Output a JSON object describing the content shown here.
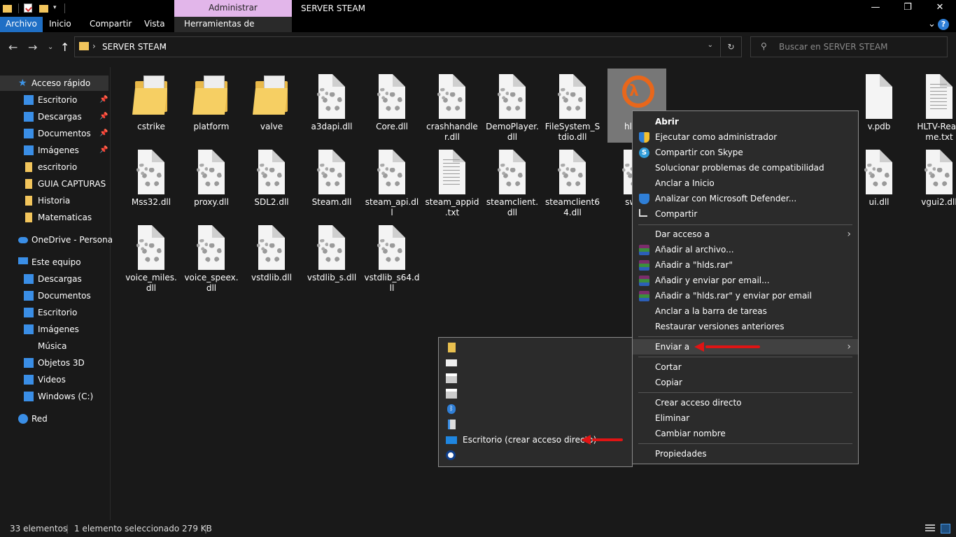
{
  "window": {
    "title": "SERVER STEAM",
    "context_tab_header": "Administrar",
    "controls": {
      "minimize": "—",
      "maximize": "❐",
      "close": "✕"
    }
  },
  "ribbon": {
    "tabs": [
      "Archivo",
      "Inicio",
      "Compartir",
      "Vista",
      "Herramientas de aplicación"
    ],
    "active_tab": "Archivo",
    "expand_icon": "⌄",
    "help_icon": "?"
  },
  "address": {
    "path": "SERVER STEAM",
    "search_placeholder": "Buscar en SERVER STEAM"
  },
  "nav": {
    "quick_access": "Acceso rápido",
    "quick_items": [
      "Escritorio",
      "Descargas",
      "Documentos",
      "Imágenes",
      "escritorio",
      "GUIA CAPTURAS",
      "Historia",
      "Matematicas"
    ],
    "onedrive": "OneDrive - Personal",
    "this_pc": "Este equipo",
    "pc_items": [
      "Descargas",
      "Documentos",
      "Escritorio",
      "Imágenes",
      "Música",
      "Objetos 3D",
      "Videos",
      "Windows (C:)"
    ],
    "network": "Red"
  },
  "files": {
    "row1": [
      "cstrike",
      "platform",
      "valve",
      "a3dapi.dll",
      "Core.dll",
      "crashhandler.dll",
      "DemoPlayer.dll",
      "FileSystem_Stdio.dll",
      "hlds.exe",
      "",
      "",
      "",
      "v.pdb",
      "HLTV-Readme.txt"
    ],
    "row1_display": [
      "cstrike",
      "platform",
      "valve",
      "a3dapi.dll",
      "Core.dll",
      "crashhandle\nr.dll",
      "DemoPlayer.\ndll",
      "FileSystem_S\ntdio.dll",
      "hlds.e",
      "",
      "",
      "",
      "v.pdb",
      "HLTV-Read\nme.txt"
    ],
    "row2_display": [
      "Mss32.dll",
      "proxy.dll",
      "SDL2.dll",
      "Steam.dll",
      "steam_api.dl\nl",
      "steam_appid\n.txt",
      "steamclient.\ndll",
      "steamclient6\n4.dll",
      "swds.",
      "",
      "",
      "ui.dll",
      "vgui2.dll"
    ],
    "row3_display": [
      "voice_miles.\ndll",
      "voice_speex.\ndll",
      "vstdlib.dll",
      "vstdlib_s.dll",
      "vstdlib_s64.d\nll"
    ]
  },
  "status": {
    "count": "33 elementos",
    "selection": "1 elemento seleccionado  279 KB"
  },
  "context_menu": {
    "open": "Abrir",
    "run_admin": "Ejecutar como administrador",
    "skype": "Compartir con Skype",
    "troubleshoot": "Solucionar problemas de compatibilidad",
    "pin_start": "Anclar a Inicio",
    "defender": "Analizar con Microsoft Defender...",
    "share": "Compartir",
    "give_access": "Dar acceso a",
    "add_archive": "Añadir al archivo...",
    "add_rar": "Añadir a \"hlds.rar\"",
    "add_email": "Añadir y enviar por email...",
    "add_rar_email": "Añadir a \"hlds.rar\" y enviar por email",
    "pin_taskbar": "Anclar a la barra de tareas",
    "restore": "Restaurar versiones anteriores",
    "send_to": "Enviar a",
    "cut": "Cortar",
    "copy": "Copiar",
    "shortcut": "Crear acceso directo",
    "delete": "Eliminar",
    "rename": "Cambiar nombre",
    "properties": "Propiedades"
  },
  "send_to_menu": {
    "desktop_shortcut": "Escritorio (crear acceso directo)"
  },
  "colors": {
    "accent": "#1f6fc5",
    "context_tab": "#e2b6ea",
    "annotation_red": "#e01414"
  }
}
